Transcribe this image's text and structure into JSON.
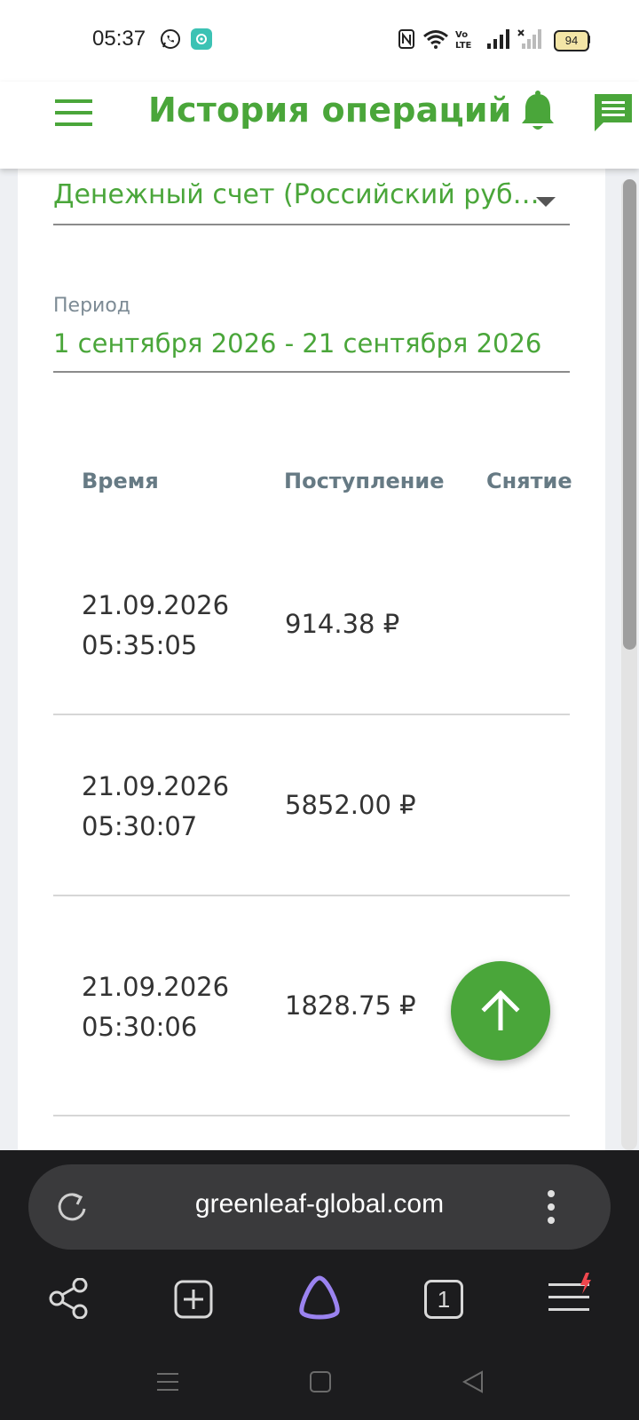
{
  "status_bar": {
    "time": "05:37",
    "battery": "94",
    "icons": [
      "whatsapp-icon",
      "app-notification-icon",
      "nfc-icon",
      "wifi-icon",
      "volte-icon",
      "signal-icon",
      "signal-no-service-icon",
      "battery-icon"
    ]
  },
  "header": {
    "title": "История операций",
    "icons": [
      "menu-icon",
      "bell-icon",
      "chat-icon"
    ]
  },
  "filters": {
    "account_select": "Денежный счет (Российский руб…",
    "period_label": "Период",
    "period_value": "1 сентября 2026 - 21 сентября 2026"
  },
  "table": {
    "columns": [
      "Время",
      "Поступление",
      "Снятие"
    ],
    "rows": [
      {
        "date": "21.09.2026",
        "time": "05:35:05",
        "income": "914.38 ₽",
        "withdrawal": ""
      },
      {
        "date": "21.09.2026",
        "time": "05:30:07",
        "income": "5852.00 ₽",
        "withdrawal": ""
      },
      {
        "date": "21.09.2026",
        "time": "05:30:06",
        "income": "1828.75 ₽",
        "withdrawal": ""
      }
    ]
  },
  "browser": {
    "url": "greenleaf-global.com",
    "tab_count": "1",
    "bottom_icons": [
      "share-icon",
      "new-tab-icon",
      "alice-assistant-icon",
      "tabs-icon",
      "browser-menu-icon"
    ]
  },
  "colors": {
    "accent": "#4aa63a",
    "header_text": "#667a84",
    "browser_bg": "#1c1c1e"
  }
}
